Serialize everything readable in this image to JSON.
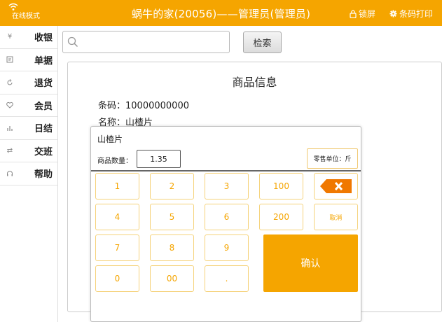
{
  "topbar": {
    "online_label": "在线模式",
    "title": "蜗牛的家(20056)——管理员(管理员)",
    "lock_label": "锁屏",
    "print_label": "条码打印"
  },
  "sidebar": {
    "items": [
      {
        "label": "收银",
        "icon": "yen-icon"
      },
      {
        "label": "单据",
        "icon": "receipt-icon"
      },
      {
        "label": "退货",
        "icon": "return-icon"
      },
      {
        "label": "会员",
        "icon": "heart-icon"
      },
      {
        "label": "日结",
        "icon": "bar-chart-icon"
      },
      {
        "label": "交班",
        "icon": "swap-icon"
      },
      {
        "label": "帮助",
        "icon": "headset-icon"
      }
    ]
  },
  "search": {
    "placeholder": "",
    "button_label": "检索"
  },
  "product": {
    "title": "商品信息",
    "barcode_line": "条码：10000000000",
    "name_line": "名称：山楂片"
  },
  "dialog": {
    "product_name": "山楂片",
    "qty_label": "商品数量：",
    "qty_value": "1.35",
    "unit_label": "零售单位：斤",
    "keys": [
      "1",
      "2",
      "3",
      "100",
      "4",
      "5",
      "6",
      "200",
      "取消",
      "7",
      "8",
      "9",
      "0",
      "00",
      "."
    ],
    "confirm_label": "确认"
  },
  "colors": {
    "accent": "#f5a500",
    "key_border": "#f5d27a",
    "delete": "#f07800"
  }
}
